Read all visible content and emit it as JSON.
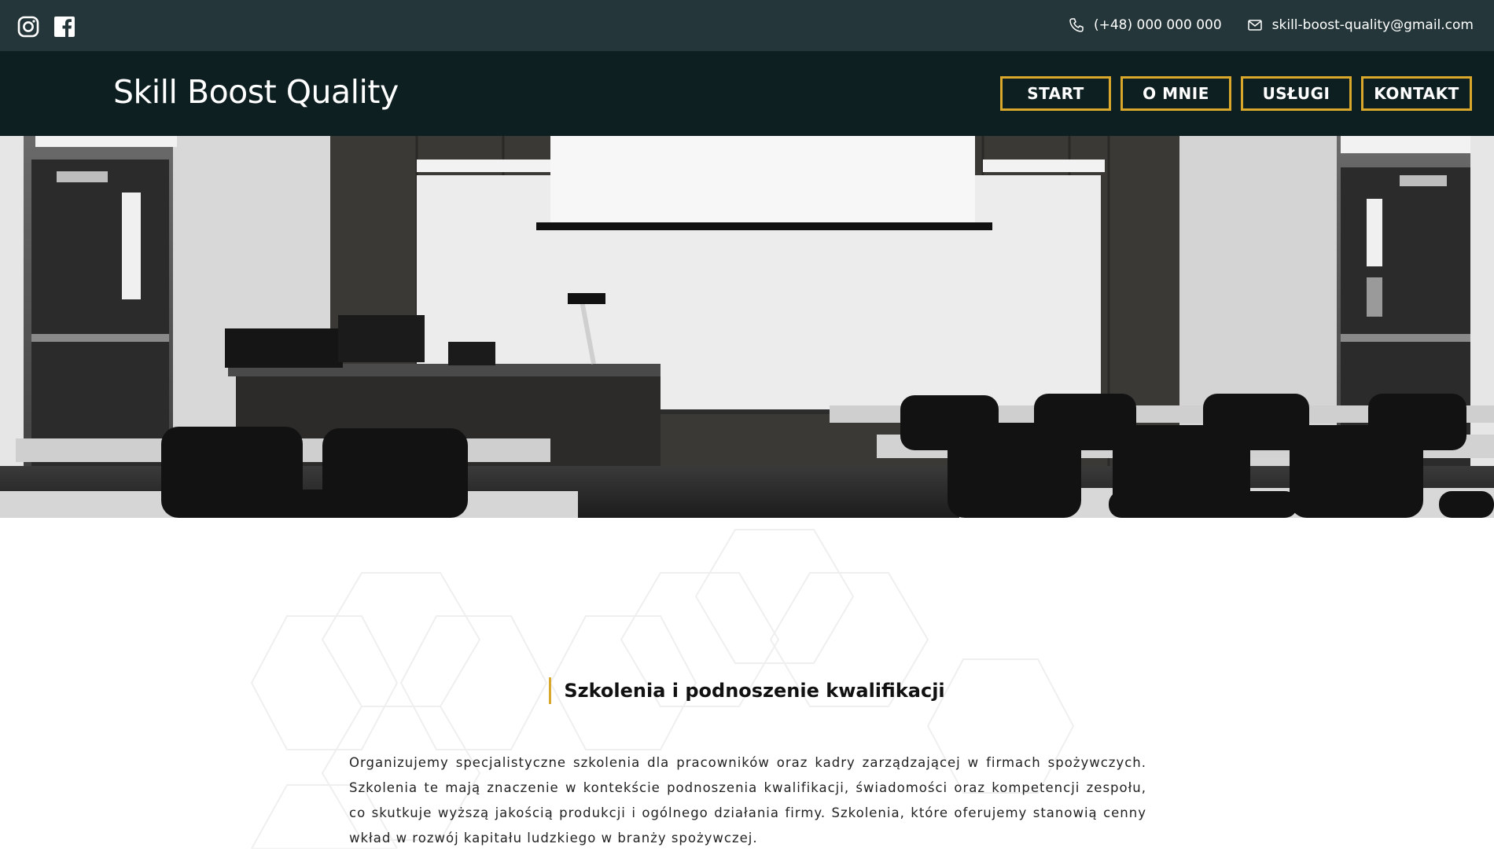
{
  "topbar": {
    "social": [
      {
        "icon": "instagram-icon"
      },
      {
        "icon": "facebook-icon"
      }
    ],
    "phone": "(+48) 000 000 000",
    "email": "skill-boost-quality@gmail.com"
  },
  "header": {
    "logo": "Skill Boost Quality",
    "nav": [
      "START",
      "O MNIE",
      "USŁUGI",
      "KONTAKT"
    ]
  },
  "hero": {
    "icon": "classroom-photo"
  },
  "section": {
    "heading": "Szkolenia i podnoszenie kwalifikacji",
    "paragraph": "Organizujemy specjalistyczne szkolenia dla pracowników oraz kadry zarządzającej w firmach spożywczych. Szkolenia te mają znaczenie w kontekście podnoszenia kwalifikacji, świadomości oraz kompetencji zespołu, co skutkuje wyższą jakością produkcji i ogólnego działania firmy. Szkolenia, które oferujemy stanowią cenny wkład w rozwój kapitału ludzkiego w branży spożywczej."
  },
  "colors": {
    "topbar": "#243639",
    "header": "#0e1f22",
    "accent": "#d9a72a"
  }
}
